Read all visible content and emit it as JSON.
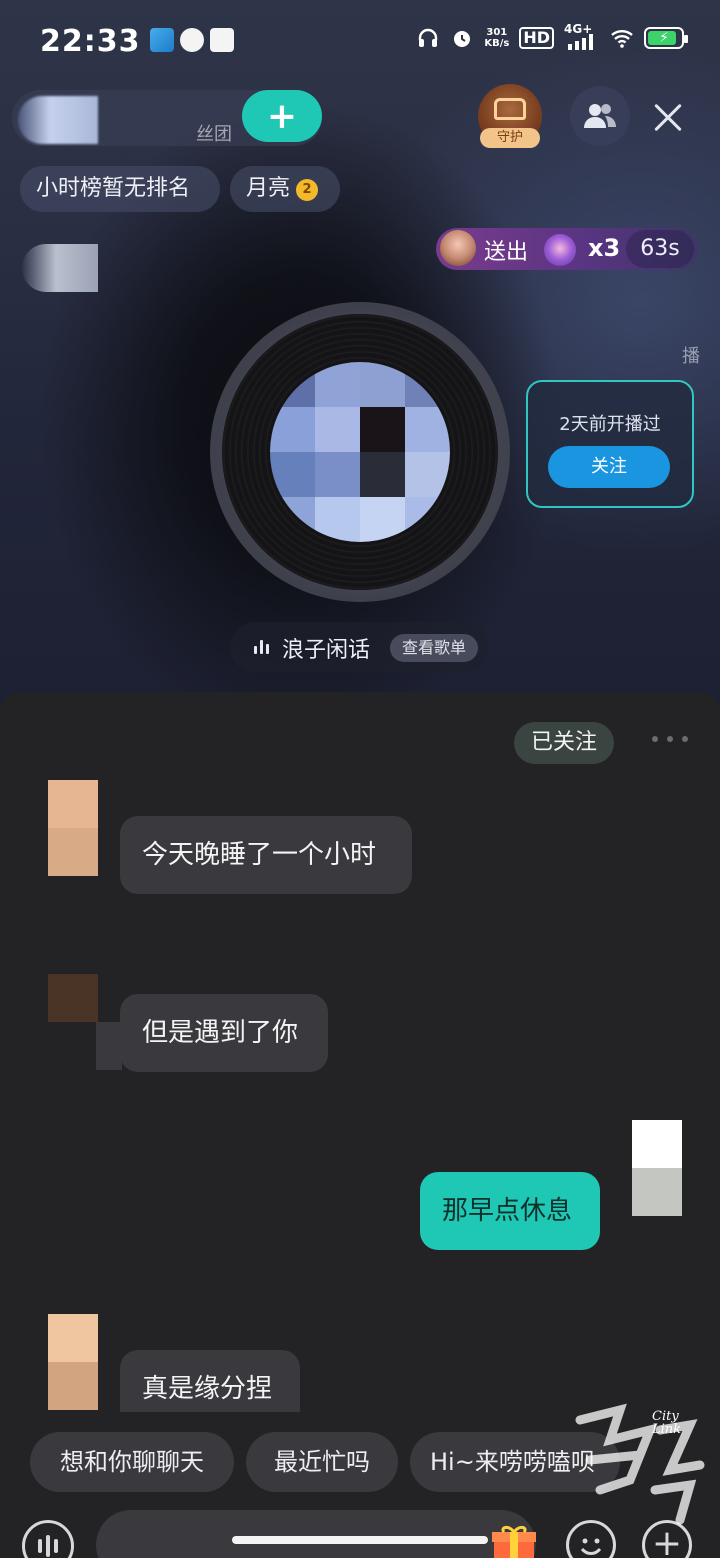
{
  "status_bar": {
    "time": "22:33",
    "net_speed": "301",
    "net_unit": "KB/s",
    "hd": "HD",
    "signal": "4G+"
  },
  "header": {
    "fans_label": "丝团",
    "follow_plus": "+",
    "guard_label": "守护",
    "rank_chip": "小时榜暂无排名",
    "moon_chip": "月亮",
    "moon_rank": "2"
  },
  "gift_banner": {
    "sent": "送出",
    "count": "x3",
    "timer": "63s"
  },
  "broadcast_tag": "播",
  "past_broadcast": {
    "text": "2天前开播过",
    "follow_label": "关注"
  },
  "song": {
    "name": "浪子闲话",
    "view_list": "查看歌单"
  },
  "chat": {
    "followed_label": "已关注",
    "messages": [
      {
        "side": "left",
        "text": "今天晚睡了一个小时"
      },
      {
        "side": "left",
        "text": "但是遇到了你"
      },
      {
        "side": "right",
        "text": "那早点休息"
      },
      {
        "side": "left",
        "text": "真是缘分捏"
      }
    ],
    "quick_replies": [
      "想和你聊聊天",
      "最近忙吗",
      "Hi~来唠唠嗑呗"
    ]
  },
  "watermark": {
    "brand_line1": "City",
    "brand_line2": "Link"
  },
  "colors": {
    "accent_teal": "#1ec8b4",
    "follow_blue": "#1a96e0",
    "panel_bg": "#232326"
  }
}
